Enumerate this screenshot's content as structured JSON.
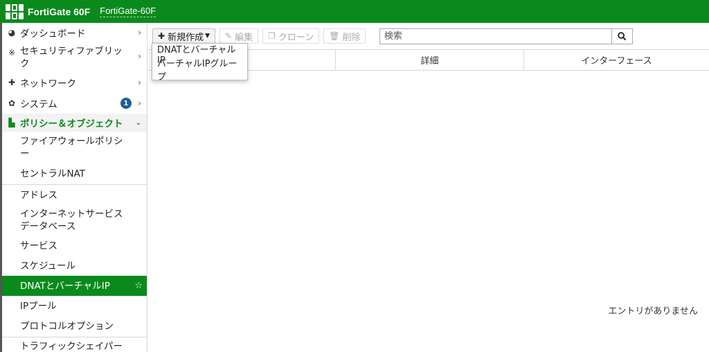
{
  "header": {
    "brand": "FortiGate 60F",
    "hostname": "FortiGate-60F"
  },
  "sidebar": {
    "items": [
      {
        "label": "ダッシュボード",
        "icon": "dashboard-icon"
      },
      {
        "label": "セキュリティファブリック",
        "icon": "fabric-icon"
      },
      {
        "label": "ネットワーク",
        "icon": "network-icon"
      },
      {
        "label": "システム",
        "icon": "gear-icon",
        "badge": "1"
      },
      {
        "label": "ポリシー＆オブジェクト",
        "icon": "policy-icon"
      }
    ],
    "subitems": [
      "ファイアウォールポリシー",
      "セントラルNAT",
      "アドレス",
      "インターネットサービスデータベース",
      "サービス",
      "スケジュール",
      "DNATとバーチャルIP",
      "IPプール",
      "プロトコルオプション",
      "トラフィックシェイパー"
    ]
  },
  "toolbar": {
    "create_new": "新規作成",
    "edit": "編集",
    "clone": "クローン",
    "delete": "削除"
  },
  "search": {
    "placeholder": "検索"
  },
  "dropdown": {
    "items": [
      "DNATとバーチャルIP",
      "バーチャルIPグループ"
    ]
  },
  "table": {
    "columns": [
      "",
      "詳細",
      "インターフェース"
    ]
  },
  "empty_message": "エントリがありません",
  "colors": {
    "brand_green": "#0a8a1c",
    "badge_blue": "#1f5e96"
  }
}
